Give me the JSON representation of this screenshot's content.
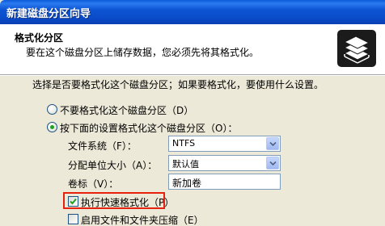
{
  "window": {
    "title": "新建磁盘分区向导"
  },
  "header": {
    "title": "格式化分区",
    "subtitle": "要在这个磁盘分区上储存数据，您必须先将其格式化。",
    "icon": "disk-stack-icon"
  },
  "body": {
    "instruction": "选择是否要格式化这个磁盘分区；如果要格式化，要使用什么设置。",
    "options": [
      {
        "label": "不要格式化这个磁盘分区（D）",
        "checked": false
      },
      {
        "label": "按下面的设置格式化这个磁盘分区（O）：",
        "checked": true
      }
    ],
    "fields": {
      "filesystem": {
        "label": "文件系统（F）：",
        "value": "NTFS"
      },
      "allocation": {
        "label": "分配单位大小（A）：",
        "value": "默认值"
      },
      "volume_label": {
        "label": "卷标（V）：",
        "value": "新加卷"
      }
    },
    "checkboxes": [
      {
        "label": "执行快速格式化（P）",
        "checked": true
      },
      {
        "label": "启用文件和文件夹压缩（E）",
        "checked": false
      }
    ]
  },
  "colors": {
    "titlebar": "#0a4bc8",
    "highlight_box": "#e8210f",
    "radio_dot": "#21a121"
  }
}
